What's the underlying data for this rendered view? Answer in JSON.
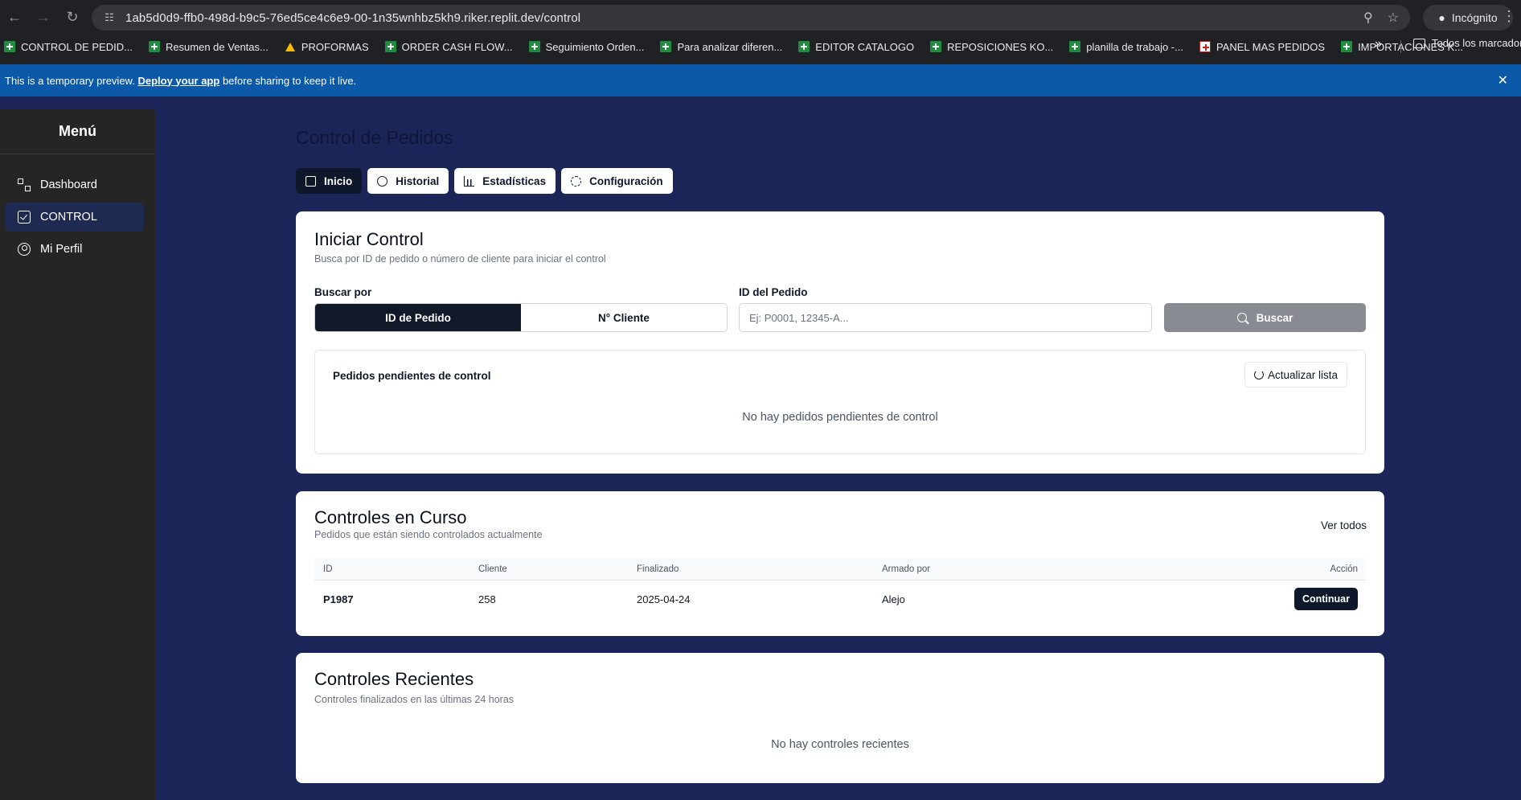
{
  "browser": {
    "url": "1ab5d0d9-ffb0-498d-b9c5-76ed5ce4c6e9-00-1n35wnhbz5kh9.riker.replit.dev/control",
    "incognito_label": "Incógnito",
    "bookmarks": [
      {
        "label": "CONTROL DE PEDID...",
        "icon": "sheets-icon"
      },
      {
        "label": "Resumen de Ventas...",
        "icon": "sheets-icon"
      },
      {
        "label": "PROFORMAS",
        "icon": "drive-icon"
      },
      {
        "label": "ORDER CASH FLOW...",
        "icon": "sheets-icon"
      },
      {
        "label": "Seguimiento Orden...",
        "icon": "sheets-icon"
      },
      {
        "label": "Para analizar diferen...",
        "icon": "sheets-icon"
      },
      {
        "label": "EDITOR CATALOGO",
        "icon": "sheets-icon"
      },
      {
        "label": "REPOSICIONES KO...",
        "icon": "sheets-icon"
      },
      {
        "label": "planilla de trabajo -...",
        "icon": "sheets-icon"
      },
      {
        "label": "PANEL MAS PEDIDOS",
        "icon": "panel-icon"
      },
      {
        "label": "IMPORTACIONES K...",
        "icon": "sheets-icon"
      }
    ],
    "all_bookmarks_label": "Todos los marcadores"
  },
  "banner": {
    "prefix": "This is a temporary preview.",
    "link": "Deploy your app",
    "suffix": "before sharing to keep it live."
  },
  "sidebar": {
    "title": "Menú",
    "items": [
      {
        "label": "Dashboard",
        "icon": "dashboard-icon"
      },
      {
        "label": "CONTROL",
        "icon": "check-square-icon",
        "active": true
      },
      {
        "label": "Mi Perfil",
        "icon": "user-circle-icon"
      }
    ]
  },
  "page": {
    "title": "Control de Pedidos",
    "tabs": [
      {
        "label": "Inicio",
        "icon": "home-icon",
        "active": true
      },
      {
        "label": "Historial",
        "icon": "history-icon"
      },
      {
        "label": "Estadísticas",
        "icon": "bar-chart-icon"
      },
      {
        "label": "Configuración",
        "icon": "gear-icon"
      }
    ]
  },
  "iniciar": {
    "title": "Iniciar Control",
    "subtitle": "Busca por ID de pedido o número de cliente para iniciar el control",
    "search_by_label": "Buscar por",
    "options": [
      "ID de Pedido",
      "N° Cliente"
    ],
    "selected_option": "ID de Pedido",
    "id_label": "ID del Pedido",
    "id_placeholder": "Ej: P0001, 12345-A...",
    "search_button": "Buscar",
    "pending_title": "Pedidos pendientes de control",
    "refresh_button": "Actualizar lista",
    "pending_empty": "No hay pedidos pendientes de control"
  },
  "en_curso": {
    "title": "Controles en Curso",
    "subtitle": "Pedidos que están siendo controlados actualmente",
    "see_all": "Ver todos",
    "columns": [
      "ID",
      "Cliente",
      "Finalizado",
      "Armado por",
      "Acción"
    ],
    "rows": [
      {
        "id": "P1987",
        "cliente": "258",
        "finalizado": "2025-04-24",
        "armado_por": "Alejo",
        "accion": "Continuar"
      }
    ]
  },
  "recientes": {
    "title": "Controles Recientes",
    "subtitle": "Controles finalizados en las últimas 24 horas",
    "empty": "No hay controles recientes"
  }
}
